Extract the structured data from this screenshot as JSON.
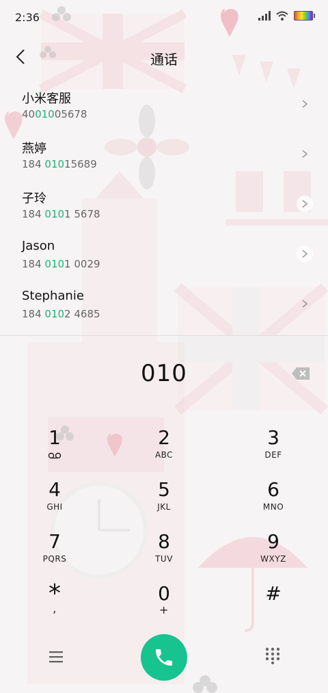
{
  "status_bar": {
    "time": "2:36",
    "icons": [
      "signal-icon",
      "wifi-icon",
      "battery-icon"
    ]
  },
  "header": {
    "title": "通话",
    "back_icon": "back-arrow-icon"
  },
  "results": [
    {
      "name": "小米客服",
      "number_pre": "40",
      "number_match": "010",
      "number_post": "05678"
    },
    {
      "name": "燕婷",
      "number_pre": "184 ",
      "number_match": "010",
      "number_post": "15689"
    },
    {
      "name": "子玲",
      "number_pre": "184 ",
      "number_match": "010",
      "number_post": "1 5678"
    },
    {
      "name": "Jason",
      "number_pre": "184 ",
      "number_match": "010",
      "number_post": "1 0029"
    },
    {
      "name": "Stephanie",
      "number_pre": "184 ",
      "number_match": "010",
      "number_post": "2 4685"
    }
  ],
  "dialer": {
    "input": "010"
  },
  "keys": [
    {
      "digit": "1",
      "letters": ""
    },
    {
      "digit": "2",
      "letters": "ABC"
    },
    {
      "digit": "3",
      "letters": "DEF"
    },
    {
      "digit": "4",
      "letters": "GHI"
    },
    {
      "digit": "5",
      "letters": "JKL"
    },
    {
      "digit": "6",
      "letters": "MNO"
    },
    {
      "digit": "7",
      "letters": "PQRS"
    },
    {
      "digit": "8",
      "letters": "TUV"
    },
    {
      "digit": "9",
      "letters": "WXYZ"
    },
    {
      "digit": "*",
      "letters": ","
    },
    {
      "digit": "0",
      "letters": "+"
    },
    {
      "digit": "#",
      "letters": ""
    }
  ],
  "colors": {
    "accent": "#17c38f",
    "highlight": "#1fb07a"
  }
}
